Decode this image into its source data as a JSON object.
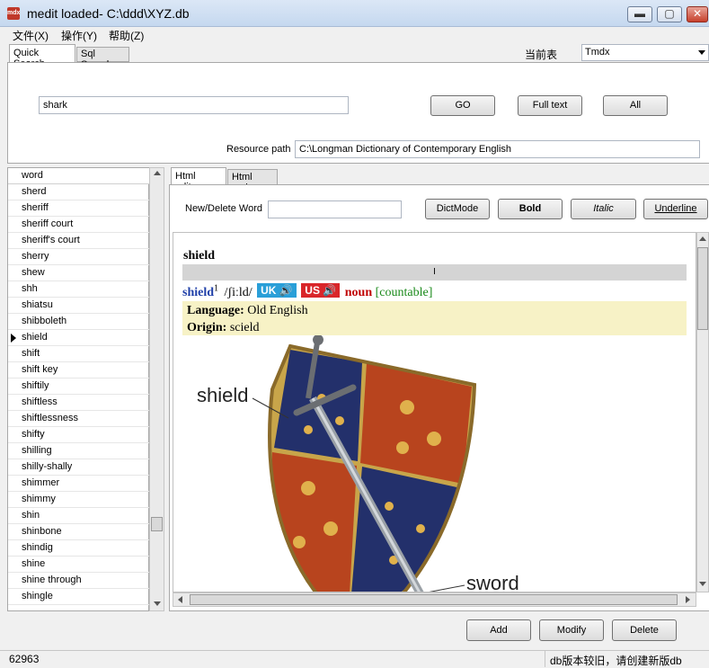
{
  "window": {
    "title": "medit loaded- C:\\ddd\\XYZ.db",
    "app_icon": "app-logo-icon",
    "buttons": {
      "minimize": "▬",
      "maximize": "▢",
      "close": "✕"
    }
  },
  "menu": {
    "items": [
      "文件(X)",
      "操作(Y)",
      "帮助(Z)"
    ]
  },
  "search_tabs": [
    {
      "label": "Quick Search",
      "active": true
    },
    {
      "label": "Sql Search",
      "active": false
    }
  ],
  "table_select": {
    "label": "当前表",
    "value": "Tmdx"
  },
  "search": {
    "query": "shark",
    "go_label": "GO",
    "fulltext_label": "Full text",
    "all_label": "All",
    "resource_label": "Resource path",
    "resource_value": "C:\\Longman Dictionary of Contemporary English"
  },
  "word_list": {
    "header": "word",
    "selected_index": 9,
    "items": [
      "sherd",
      "sheriff",
      "sheriff court",
      "sheriff's court",
      "sherry",
      "shew",
      "shh",
      "shiatsu",
      "shibboleth",
      "shield",
      "shift",
      "shift key",
      "shiftily",
      "shiftless",
      "shiftlessness",
      "shifty",
      "shilling",
      "shilly-shally",
      "shimmer",
      "shimmy",
      "shin",
      "shinbone",
      "shindig",
      "shine",
      "shine through",
      "shingle"
    ]
  },
  "editor_tabs": [
    {
      "label": "Html editor",
      "active": true
    },
    {
      "label": "Html code",
      "active": false
    }
  ],
  "toolbar": {
    "new_delete_label": "New/Delete Word",
    "new_delete_value": "",
    "dictmode_label": "DictMode",
    "bold_label": "Bold",
    "italic_label": "Italic",
    "underline_label": "Underline"
  },
  "entry": {
    "headword": "shield",
    "divider_glyph": "I",
    "word": "shield",
    "superscript": "1",
    "pronunciation": "/ʃiːld/",
    "uk_label": "UK",
    "us_label": "US",
    "pos": "noun",
    "grammar": "[countable]",
    "etymology": {
      "language_label": "Language:",
      "language_value": "Old English",
      "origin_label": "Origin:",
      "origin_value": "scield"
    },
    "image_labels": {
      "shield": "shield",
      "sword": "sword"
    }
  },
  "actions": {
    "add_label": "Add",
    "modify_label": "Modify",
    "delete_label": "Delete"
  },
  "status": {
    "count": "62963",
    "message": "db版本较旧，请创建新版db"
  },
  "colors": {
    "uk_badge": "#2a9fd8",
    "us_badge": "#d9262a",
    "word_blue": "#1f3fa8",
    "pos_red": "#c00000",
    "grammar_green": "#1a8a1a",
    "etym_bg": "#f7f2c6"
  }
}
